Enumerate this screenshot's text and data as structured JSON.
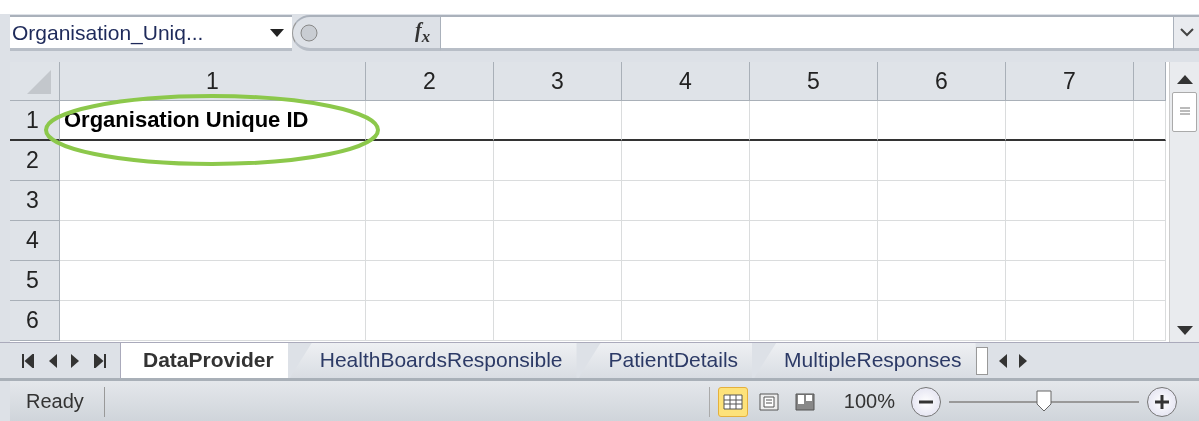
{
  "formula_bar": {
    "name_box": "Organisation_Uniq...",
    "function_label": "f$_{x}$"
  },
  "grid": {
    "columns": [
      "1",
      "2",
      "3",
      "4",
      "5",
      "6",
      "7"
    ],
    "rows": [
      {
        "header": "1",
        "cells": [
          {
            "text": "Organisation Unique ID",
            "bold": true
          }
        ]
      },
      {
        "header": "2",
        "cells": []
      },
      {
        "header": "3",
        "cells": []
      },
      {
        "header": "4",
        "cells": []
      },
      {
        "header": "5",
        "cells": []
      },
      {
        "header": "6",
        "cells": []
      }
    ]
  },
  "sheet_tabs": [
    {
      "label": "DataProvider",
      "selected": true
    },
    {
      "label": "HealthBoardsResponsible",
      "selected": false
    },
    {
      "label": "PatientDetails",
      "selected": false
    },
    {
      "label": "MultipleResponses",
      "selected": false
    }
  ],
  "status_bar": {
    "status": "Ready",
    "views": [
      {
        "kind": "normal",
        "selected": true
      },
      {
        "kind": "layout",
        "selected": false
      },
      {
        "kind": "pagebreak",
        "selected": false
      }
    ],
    "zoom": "100%",
    "zoom_slider": {
      "level": 0.5
    }
  }
}
